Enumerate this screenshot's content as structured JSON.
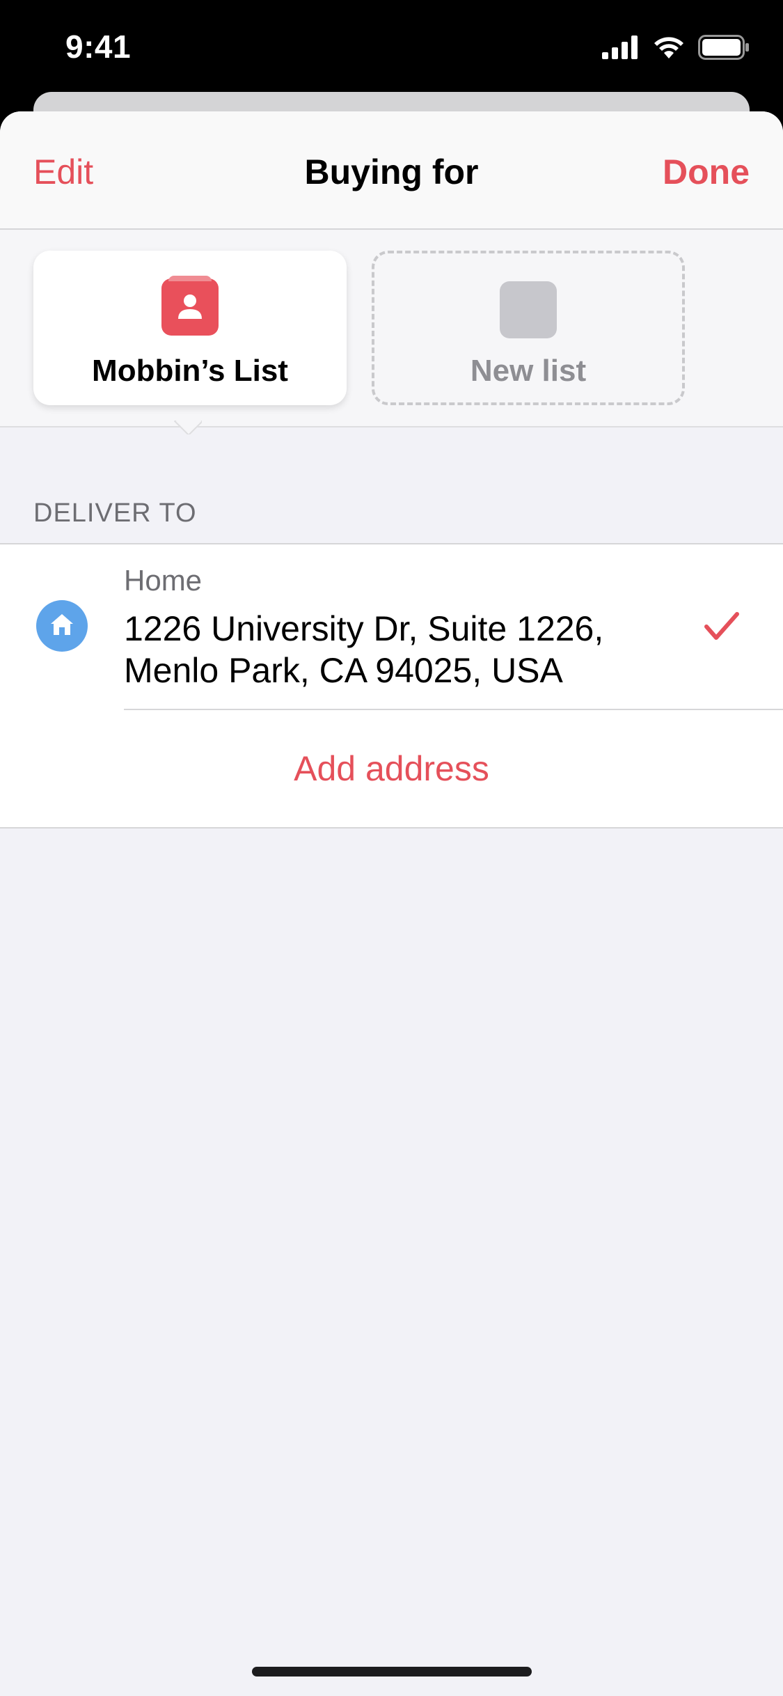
{
  "status_bar": {
    "time": "9:41",
    "icons": [
      "cellular-signal-icon",
      "wifi-icon",
      "battery-icon"
    ]
  },
  "nav": {
    "edit_label": "Edit",
    "title": "Buying for",
    "done_label": "Done"
  },
  "lists": {
    "items": [
      {
        "label": "Mobbin’s List",
        "icon": "person-list-icon",
        "selected": true,
        "color": "#e9505b"
      },
      {
        "label": "New list",
        "icon": "blank-list-icon",
        "selected": false,
        "color": "#c7c7cc"
      }
    ]
  },
  "delivery": {
    "section_header": "DELIVER TO",
    "addresses": [
      {
        "name": "Home",
        "line1": "1226 University Dr, Suite 1226,",
        "line2": "Menlo Park, CA 94025, USA",
        "icon": "home-icon",
        "selected": true
      }
    ],
    "add_address_label": "Add address"
  },
  "colors": {
    "accent": "#e5505a",
    "home_badge": "#5ea4ea"
  }
}
